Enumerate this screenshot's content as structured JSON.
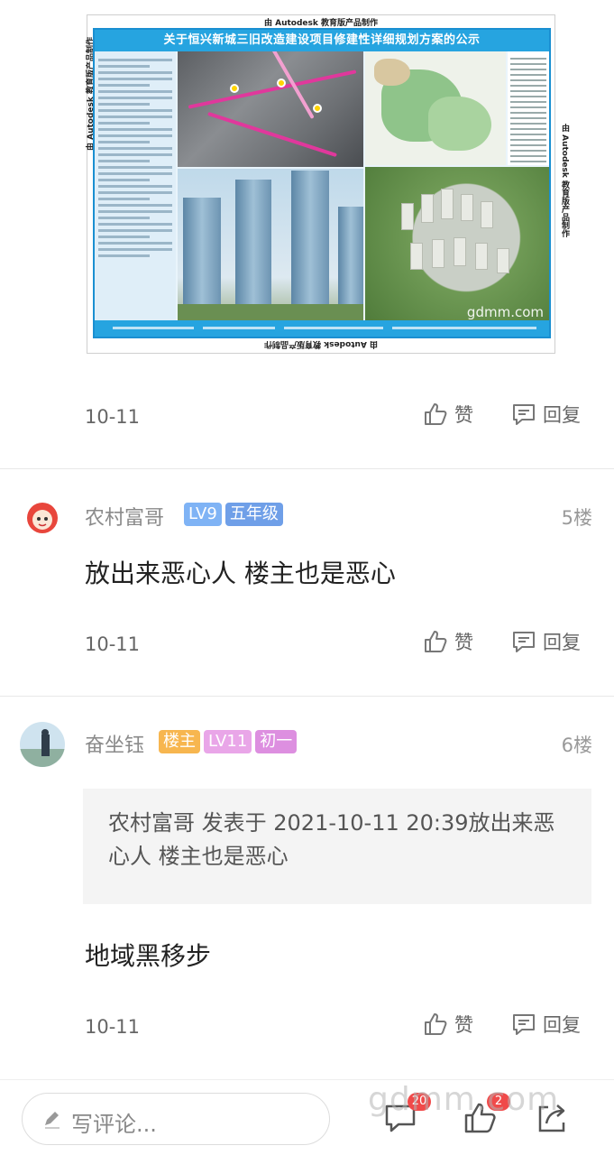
{
  "poster": {
    "title": "关于恒兴新城三旧改造建设项目修建性详细规划方案的公示",
    "ad_text": "由 Autodesk 教育版产品制作",
    "watermark": "gdmm.com"
  },
  "first_meta": {
    "date": "10-11",
    "like_label": "赞",
    "reply_label": "回复"
  },
  "comments": [
    {
      "username": "农村富哥",
      "badges": [
        {
          "text": "LV9",
          "color": "#7fb3f5"
        },
        {
          "text": "五年级",
          "color": "#6f9fe8"
        }
      ],
      "floor": "5楼",
      "content": "放出来恶心人  楼主也是恶心",
      "date": "10-11",
      "like_label": "赞",
      "reply_label": "回复"
    },
    {
      "username": "奋坐钰",
      "badges": [
        {
          "text": "楼主",
          "color": "#f7b64f"
        },
        {
          "text": "LV11",
          "color": "#e9a6e8"
        },
        {
          "text": "初一",
          "color": "#dd8fe0"
        }
      ],
      "floor": "6楼",
      "quote": "农村富哥 发表于 2021-10-11 20:39放出来恶心人  楼主也是恶心",
      "content": "地域黑移步",
      "date": "10-11",
      "like_label": "赞",
      "reply_label": "回复"
    }
  ],
  "bottom_bar": {
    "placeholder": "写评论...",
    "comment_count": "20",
    "like_count": "2",
    "watermark": "gdmm.com"
  },
  "colors": {
    "accent": "#26a4e0",
    "badge_red": "#f04a4a"
  }
}
